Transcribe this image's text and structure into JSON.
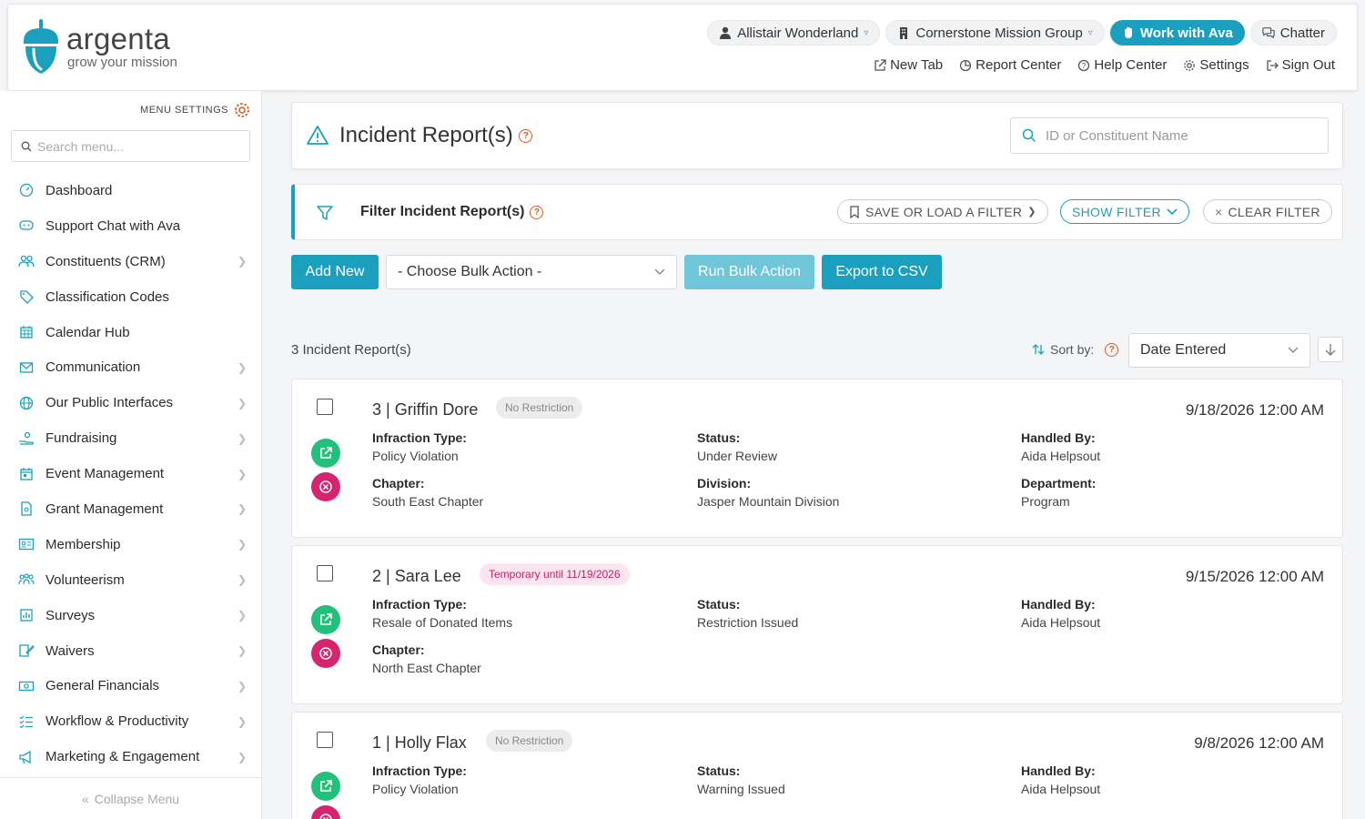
{
  "brand": {
    "name": "argenta",
    "tagline": "grow your mission"
  },
  "header": {
    "user": "Allistair Wonderland",
    "org": "Cornerstone Mission Group",
    "ava_button": "Work with Ava",
    "chatter": "Chatter",
    "links": [
      "New Tab",
      "Report Center",
      "Help Center",
      "Settings",
      "Sign Out"
    ]
  },
  "sidebar": {
    "menu_settings": "MENU SETTINGS",
    "search_placeholder": "Search menu...",
    "items": [
      {
        "label": "Dashboard",
        "icon": "gauge-icon",
        "has_children": false
      },
      {
        "label": "Support Chat with Ava",
        "icon": "chat-icon",
        "has_children": false
      },
      {
        "label": "Constituents (CRM)",
        "icon": "people-icon",
        "has_children": true
      },
      {
        "label": "Classification Codes",
        "icon": "tag-icon",
        "has_children": false
      },
      {
        "label": "Calendar Hub",
        "icon": "calendar-icon",
        "has_children": false
      },
      {
        "label": "Communication",
        "icon": "envelope-icon",
        "has_children": true
      },
      {
        "label": "Our Public Interfaces",
        "icon": "globe-icon",
        "has_children": true
      },
      {
        "label": "Fundraising",
        "icon": "hand-coin-icon",
        "has_children": true
      },
      {
        "label": "Event Management",
        "icon": "event-icon",
        "has_children": true
      },
      {
        "label": "Grant Management",
        "icon": "document-icon",
        "has_children": true
      },
      {
        "label": "Membership",
        "icon": "id-card-icon",
        "has_children": true
      },
      {
        "label": "Volunteerism",
        "icon": "volunteer-icon",
        "has_children": true
      },
      {
        "label": "Surveys",
        "icon": "survey-icon",
        "has_children": true
      },
      {
        "label": "Waivers",
        "icon": "signature-icon",
        "has_children": true
      },
      {
        "label": "General Financials",
        "icon": "money-icon",
        "has_children": true
      },
      {
        "label": "Workflow & Productivity",
        "icon": "checklist-icon",
        "has_children": true
      },
      {
        "label": "Marketing & Engagement",
        "icon": "megaphone-icon",
        "has_children": true
      }
    ],
    "collapse": "Collapse Menu"
  },
  "page": {
    "title": "Incident Report(s)",
    "search_placeholder": "ID or Constituent Name",
    "filter_title": "Filter Incident Report(s)",
    "save_load_filter": "SAVE OR LOAD A FILTER",
    "show_filter": "SHOW FILTER",
    "clear_filter": "CLEAR FILTER",
    "add_new": "Add New",
    "bulk_action": "- Choose Bulk Action -",
    "run_bulk": "Run Bulk Action",
    "export_csv": "Export to CSV",
    "count": "3 Incident Report(s)",
    "sort_by_label": "Sort by:",
    "sort_by_value": "Date Entered"
  },
  "reports": [
    {
      "title": "3 | Griffin Dore",
      "badge": "No Restriction",
      "badge_type": "none",
      "date": "9/18/2026 12:00 AM",
      "fields": [
        {
          "label": "Infraction Type:",
          "value": "Policy Violation"
        },
        {
          "label": "Status:",
          "value": "Under Review"
        },
        {
          "label": "Handled By:",
          "value": "Aida Helpsout"
        },
        {
          "label": "Chapter:",
          "value": "South East Chapter"
        },
        {
          "label": "Division:",
          "value": "Jasper Mountain Division"
        },
        {
          "label": "Department:",
          "value": "Program"
        }
      ]
    },
    {
      "title": "2 | Sara Lee",
      "badge": "Temporary until 11/19/2026",
      "badge_type": "temp",
      "date": "9/15/2026 12:00 AM",
      "fields": [
        {
          "label": "Infraction Type:",
          "value": "Resale of Donated Items"
        },
        {
          "label": "Status:",
          "value": "Restriction Issued"
        },
        {
          "label": "Handled By:",
          "value": "Aida Helpsout"
        },
        {
          "label": "Chapter:",
          "value": "North East Chapter"
        }
      ]
    },
    {
      "title": "1 | Holly Flax",
      "badge": "No Restriction",
      "badge_type": "none",
      "date": "9/8/2026 12:00 AM",
      "fields": [
        {
          "label": "Infraction Type:",
          "value": "Policy Violation"
        },
        {
          "label": "Status:",
          "value": "Warning Issued"
        },
        {
          "label": "Handled By:",
          "value": "Aida Helpsout"
        }
      ]
    }
  ],
  "colors": {
    "accent": "#1aa0be",
    "open": "#22c07a",
    "delete": "#d6246e",
    "help": "#e05a1a"
  }
}
